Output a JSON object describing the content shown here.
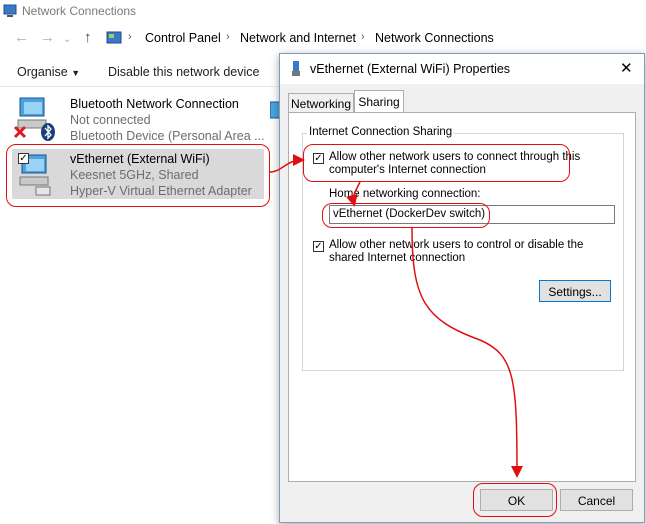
{
  "window": {
    "title": "Network Connections"
  },
  "address_bar": {
    "crumbs": [
      "Control Panel",
      "Network and Internet",
      "Network Connections"
    ]
  },
  "command_bar": {
    "organise": "Organise",
    "disable": "Disable this network device"
  },
  "connections": [
    {
      "name": "Bluetooth Network Connection",
      "status": "Not connected",
      "device": "Bluetooth Device (Personal Area ..."
    },
    {
      "name": "vEthernet (External WiFi)",
      "status": "Keesnet 5GHz, Shared",
      "device": "Hyper-V Virtual Ethernet Adapter"
    }
  ],
  "dialog": {
    "title": "vEthernet (External WiFi) Properties",
    "tabs": [
      "Networking",
      "Sharing"
    ],
    "active_tab": "Sharing",
    "group_label": "Internet Connection Sharing",
    "allow_connect_line1": "Allow other network users to connect through this",
    "allow_connect_line2": "computer's Internet connection",
    "home_label": "Home networking connection:",
    "home_value": "vEthernet (DockerDev switch)",
    "allow_control_line1": "Allow other network users to control or disable the",
    "allow_control_line2": "shared Internet connection",
    "settings_button": "Settings...",
    "ok_button": "OK",
    "cancel_button": "Cancel"
  },
  "colors": {
    "annotation_red": "#e01010",
    "selection_bg": "#d9d9d9"
  }
}
